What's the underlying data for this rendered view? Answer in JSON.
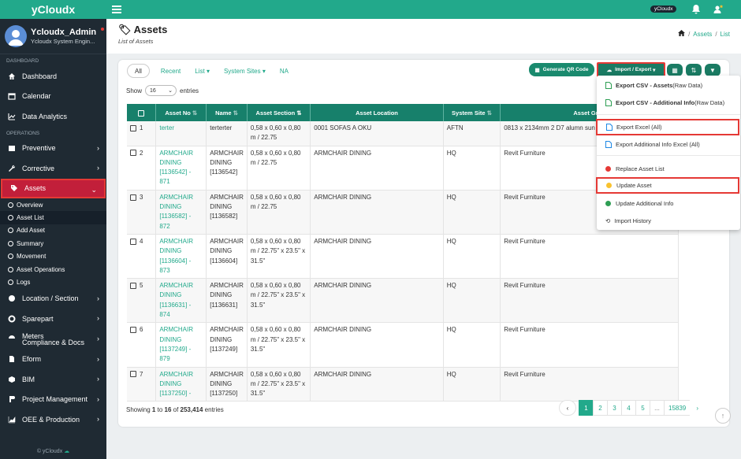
{
  "brand": "yCloudx",
  "user": {
    "name": "Ycloudx_Admin",
    "role": "Ycloudx System Engin..."
  },
  "sidebar": {
    "section_dashboard": "DASHBOARD",
    "section_operations": "OPERATIONS",
    "items_top": [
      {
        "label": "Dashboard"
      },
      {
        "label": "Calendar"
      },
      {
        "label": "Data Analytics"
      }
    ],
    "items_ops": [
      {
        "label": "Preventive"
      },
      {
        "label": "Corrective"
      },
      {
        "label": "Assets"
      }
    ],
    "sub_items": [
      {
        "label": "Overview"
      },
      {
        "label": "Asset List"
      },
      {
        "label": "Add Asset"
      },
      {
        "label": "Summary"
      },
      {
        "label": "Movement"
      },
      {
        "label": "Asset Operations"
      },
      {
        "label": "Logs"
      }
    ],
    "items_bottom": [
      {
        "label": "Location / Section"
      },
      {
        "label": "Sparepart"
      },
      {
        "label": "Meters"
      },
      {
        "label": "Compliance & Docs"
      },
      {
        "label": "Eform"
      },
      {
        "label": "BIM"
      },
      {
        "label": "Project Management"
      },
      {
        "label": "OEE & Production"
      }
    ],
    "footer": "© yCloudx"
  },
  "topbar": {
    "tag": "yCloudx"
  },
  "page": {
    "title": "Assets",
    "subtitle": "List of Assets",
    "breadcrumb": [
      "Assets",
      "List"
    ]
  },
  "tabs": [
    "All",
    "Recent",
    "List",
    "System Sites",
    "NA"
  ],
  "buttons": {
    "qr": "Generate QR Code",
    "import_export": "Import / Export"
  },
  "show": {
    "label": "Show",
    "value": "16",
    "suffix": "entries"
  },
  "table": {
    "headers": [
      "Asset No",
      "Name",
      "Asset Section",
      "Asset Location",
      "System Site",
      "Asset Grou"
    ],
    "rows": [
      {
        "n": "1",
        "asset_no": "terter",
        "name": "terterter",
        "section": "0,58 x 0,60 x 0,80 m / 22.75",
        "location": "0001 SOFAS A OKU",
        "site": "AFTN",
        "group": "0813 x 2134mm 2 D7 alumn sun"
      },
      {
        "n": "2",
        "asset_no": "ARMCHAIR DINING [1136542] - 871",
        "name": "ARMCHAIR DINING [1136542]",
        "section": "0,58 x 0,60 x 0,80 m / 22.75",
        "location": "ARMCHAIR DINING",
        "site": "HQ",
        "group": "Revit Furniture"
      },
      {
        "n": "3",
        "asset_no": "ARMCHAIR DINING [1136582] - 872",
        "name": "ARMCHAIR DINING [1136582]",
        "section": "0,58 x 0,60 x 0,80 m / 22.75",
        "location": "ARMCHAIR DINING",
        "site": "HQ",
        "group": "Revit Furniture"
      },
      {
        "n": "4",
        "asset_no": "ARMCHAIR DINING [1136604] - 873",
        "name": "ARMCHAIR DINING [1136604]",
        "section": "0,58 x 0,60 x 0,80 m / 22.75\" x 23.5\" x 31.5\"",
        "location": "ARMCHAIR DINING",
        "site": "HQ",
        "group": "Revit Furniture"
      },
      {
        "n": "5",
        "asset_no": "ARMCHAIR DINING [1136631] - 874",
        "name": "ARMCHAIR DINING [1136631]",
        "section": "0,58 x 0,60 x 0,80 m / 22.75\" x 23.5\" x 31.5\"",
        "location": "ARMCHAIR DINING",
        "site": "HQ",
        "group": "Revit Furniture"
      },
      {
        "n": "6",
        "asset_no": "ARMCHAIR DINING [1137249] - 879",
        "name": "ARMCHAIR DINING [1137249]",
        "section": "0,58 x 0,60 x 0,80 m / 22.75\" x 23.5\" x 31.5\"",
        "location": "ARMCHAIR DINING",
        "site": "HQ",
        "group": "Revit Furniture"
      },
      {
        "n": "7",
        "asset_no": "ARMCHAIR DINING [1137250] -",
        "name": "ARMCHAIR DINING [1137250]",
        "section": "0,58 x 0,60 x 0,80 m / 22.75\" x 23.5\" x 31.5\"",
        "location": "ARMCHAIR DINING",
        "site": "HQ",
        "group": "Revit Furniture"
      }
    ]
  },
  "footer": {
    "showing": "Showing ",
    "from": "1",
    "to_label": " to ",
    "to": "16",
    "of_label": " of ",
    "total": "253,414",
    "suffix": " entries"
  },
  "pagination": [
    "1",
    "2",
    "3",
    "4",
    "5",
    "...",
    "15839"
  ],
  "menu": {
    "csv_assets_bold": "Export CSV - Assets",
    "csv_assets_rest": " (Raw Data)",
    "csv_info_bold": "Export CSV - Additional Info",
    "csv_info_rest": " (Raw Data)",
    "excel_all": "Export Excel (All)",
    "excel_info": "Export Additional Info Excel (All)",
    "replace": "Replace Asset List",
    "update_asset": "Update Asset",
    "update_info": "Update Additional Info",
    "history": "Import History"
  },
  "colors": {
    "brand": "#22a98b",
    "header_dark": "#17806b",
    "sidebar": "#1f2a33",
    "highlight": "#e53935"
  }
}
